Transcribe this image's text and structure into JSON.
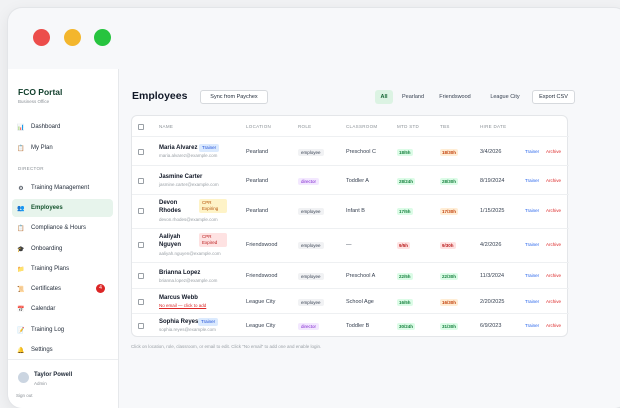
{
  "app": {
    "name": "FCO Portal",
    "subtitle": "Business Office"
  },
  "sidebar": {
    "top_items": [
      {
        "label": "Dashboard",
        "icon": "chart-icon"
      },
      {
        "label": "My Plan",
        "icon": "clipboard-icon"
      }
    ],
    "section_label": "DIRECTOR",
    "items": [
      {
        "label": "Training Management",
        "icon": "gear-icon"
      },
      {
        "label": "Employees",
        "icon": "users-icon",
        "active": true
      },
      {
        "label": "Compliance & Hours",
        "icon": "clipboard-icon"
      },
      {
        "label": "Onboarding",
        "icon": "graduation-cap-icon"
      },
      {
        "label": "Training Plans",
        "icon": "folder-icon"
      },
      {
        "label": "Certificates",
        "icon": "certificate-icon",
        "badge": "4"
      },
      {
        "label": "Calendar",
        "icon": "calendar-icon"
      },
      {
        "label": "Training Log",
        "icon": "log-icon"
      },
      {
        "label": "Settings",
        "icon": "settings-icon"
      }
    ],
    "user": {
      "name": "Taylor Powell",
      "role": "Admin"
    },
    "signout": "Sign out"
  },
  "main": {
    "title": "Employees",
    "sync_button": "Sync from Paychex",
    "filters": [
      "All",
      "Pearland",
      "Friendswood",
      "League City"
    ],
    "active_filter": "All",
    "export_button": "Export CSV",
    "columns": [
      "NAME",
      "LOCATION",
      "ROLE",
      "CLASSROOM",
      "MTD STD",
      "TBS",
      "HIRE DATE"
    ],
    "actions": {
      "trainer": "Trainer",
      "archive": "Archive"
    },
    "rows": [
      {
        "name": "Maria Alvarez",
        "badge": "Trainer",
        "badge_type": "trainer",
        "email": "maria.alvarez@example.com",
        "location": "Pearland",
        "role": "employee",
        "classroom": "Preschool C",
        "mtd": "18/5h",
        "mtd_color": "green",
        "tbs": "18/30h",
        "tbs_color": "orange",
        "hire_date": "3/4/2026"
      },
      {
        "name": "Jasmine Carter",
        "badge": "",
        "badge_type": "",
        "email": "jasmine.carter@example.com",
        "location": "Pearland",
        "role": "director",
        "classroom": "Toddler A",
        "mtd": "28/24h",
        "mtd_color": "green",
        "tbs": "28/30h",
        "tbs_color": "green",
        "hire_date": "8/19/2024"
      },
      {
        "name": "Devon Rhodes",
        "badge": "CPR Expiring",
        "badge_type": "cpr-expiring",
        "email": "devon.rhodes@example.com",
        "location": "Pearland",
        "role": "employee",
        "classroom": "Infant B",
        "mtd": "17/5h",
        "mtd_color": "green",
        "tbs": "17/30h",
        "tbs_color": "orange",
        "hire_date": "1/15/2025"
      },
      {
        "name": "Aaliyah Nguyen",
        "badge": "CPR Expired",
        "badge_type": "cpr-expired",
        "email": "aaliyah.nguyen@example.com",
        "location": "Friendswood",
        "role": "employee",
        "classroom": "—",
        "mtd": "9/5h",
        "mtd_color": "red",
        "tbs": "9/30h",
        "tbs_color": "red",
        "hire_date": "4/2/2026"
      },
      {
        "name": "Brianna Lopez",
        "badge": "",
        "badge_type": "",
        "email": "brianna.lopez@example.com",
        "location": "Friendswood",
        "role": "employee",
        "classroom": "Preschool A",
        "mtd": "22/5h",
        "mtd_color": "green",
        "tbs": "22/30h",
        "tbs_color": "green",
        "hire_date": "11/3/2024"
      },
      {
        "name": "Marcus Webb",
        "badge": "",
        "badge_type": "",
        "email": "No email — click to add",
        "email_missing": true,
        "location": "League City",
        "role": "employee",
        "classroom": "School Age",
        "mtd": "16/5h",
        "mtd_color": "green",
        "tbs": "16/30h",
        "tbs_color": "orange",
        "hire_date": "2/20/2025"
      },
      {
        "name": "Sophia Reyes",
        "badge": "Trainer",
        "badge_type": "trainer",
        "email": "sophia.reyes@example.com",
        "location": "League City",
        "role": "director",
        "classroom": "Toddler B",
        "mtd": "30/24h",
        "mtd_color": "green",
        "tbs": "31/30h",
        "tbs_color": "green",
        "hire_date": "6/9/2023"
      }
    ],
    "hint": "Click on location, role, classroom, or email to edit. Click \"No email\" to add one and enable login."
  }
}
